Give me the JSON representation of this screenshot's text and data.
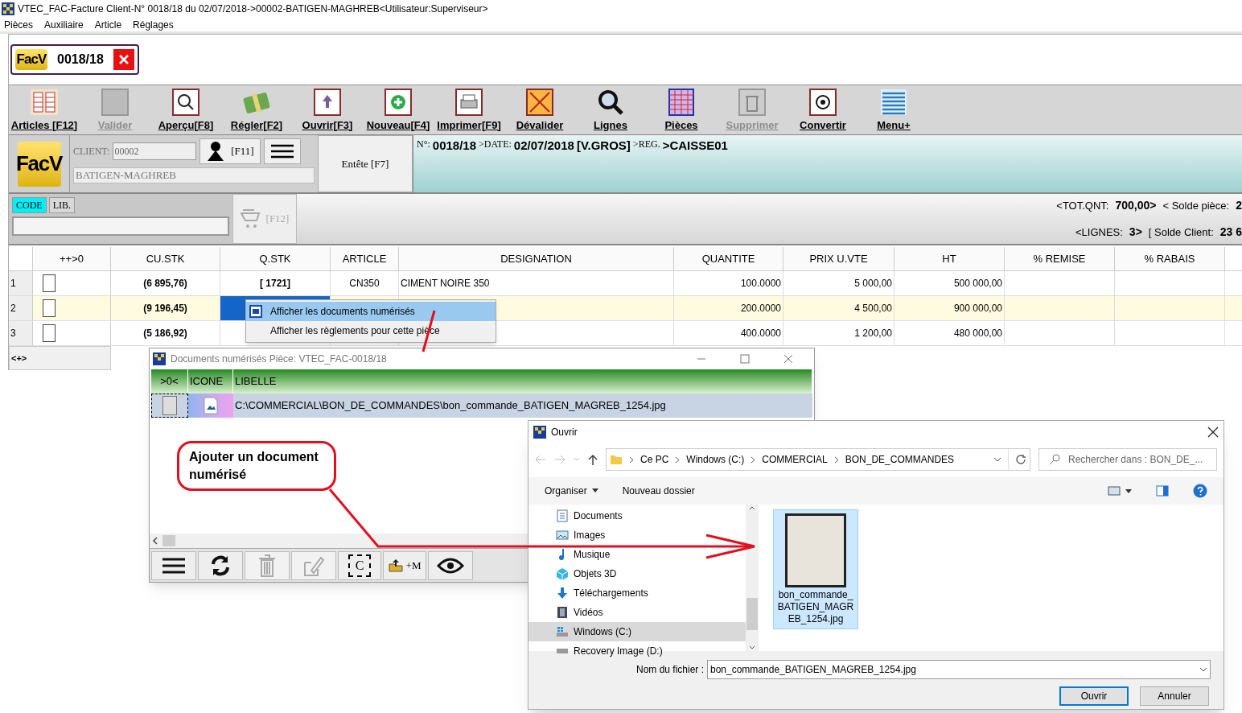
{
  "window": {
    "title": "VTEC_FAC-Facture Client-N° 0018/18 du 02/07/2018->00002-BATIGEN-MAGHREB<Utilisateur:Superviseur>"
  },
  "menu": [
    "Pièces",
    "Auxiliaire",
    "Article",
    "Réglages"
  ],
  "doc_tab": {
    "badge": "FacV",
    "number": "0018/18"
  },
  "toolbar": [
    {
      "label": "Articles [F12]",
      "kind": "grid",
      "disabled": false
    },
    {
      "label": "Valider",
      "kind": "square",
      "disabled": true
    },
    {
      "label": "Aperçu[F8]",
      "kind": "preview",
      "disabled": false
    },
    {
      "label": "Régler[F2]",
      "kind": "money",
      "disabled": false
    },
    {
      "label": "Ouvrir[F3]",
      "kind": "upload",
      "disabled": false
    },
    {
      "label": "Nouveau[F4]",
      "kind": "add",
      "disabled": false
    },
    {
      "label": "Imprimer[F9]",
      "kind": "printer",
      "disabled": false
    },
    {
      "label": "Dévalider",
      "kind": "cross",
      "disabled": false
    },
    {
      "label": "Lignes",
      "kind": "search",
      "disabled": false
    },
    {
      "label": "Pièces",
      "kind": "pieces",
      "disabled": false
    },
    {
      "label": "Supprimer",
      "kind": "trash",
      "disabled": true
    },
    {
      "label": "Convertir",
      "kind": "convert",
      "disabled": false
    },
    {
      "label": "Menu+",
      "kind": "menu",
      "disabled": false
    }
  ],
  "client": {
    "badge": "FacV",
    "label": "CLIENT:",
    "code": "00002",
    "name": "BATIGEN-MAGHREB",
    "lookup_key": "[F11]",
    "header_button": "Entête [F7]"
  },
  "info_strip": [
    {
      "text": "N°:",
      "kind": "label"
    },
    {
      "text": "0018/18",
      "kind": "value"
    },
    {
      "text": ">DATE:",
      "kind": "label"
    },
    {
      "text": "02/07/2018",
      "kind": "value"
    },
    {
      "text": "[V.GROS]",
      "kind": "value"
    },
    {
      "text": ">REG.",
      "kind": "label"
    },
    {
      "text": ">CAISSE01",
      "kind": "value"
    }
  ],
  "search": {
    "modes": [
      {
        "label": "CODE",
        "selected": true
      },
      {
        "label": "LIB.",
        "selected": false
      }
    ],
    "cart_key": "[F12]"
  },
  "totals": [
    [
      {
        "text": "<TOT.QNT:",
        "kind": "label"
      },
      {
        "text": "700,00>",
        "kind": "value"
      },
      {
        "text": "< Solde pièce:",
        "kind": "label"
      },
      {
        "text": "2",
        "kind": "value"
      }
    ],
    [
      {
        "text": "<LIGNES:",
        "kind": "label"
      },
      {
        "text": "3>",
        "kind": "value"
      },
      {
        "text": "[ Solde Client:",
        "kind": "label"
      },
      {
        "text": "23 6",
        "kind": "value"
      }
    ]
  ],
  "table": {
    "columns": [
      "++>0",
      "CU.STK",
      "Q.STK",
      "ARTICLE",
      "DESIGNATION",
      "QUANTITE",
      "PRIX U.VTE",
      "HT",
      "% REMISE",
      "% RABAIS"
    ],
    "rows": [
      {
        "number": "1",
        "checked": false,
        "selected": false,
        "cu_stk": "(6 895,76)",
        "q_stk": "[ 1721]",
        "article": "CN350",
        "designation": "CIMENT NOIRE 350",
        "quantite": "100.0000",
        "prix": "5 000,00",
        "ht": "500 000,00"
      },
      {
        "number": "2",
        "checked": false,
        "selected": true,
        "cu_stk": "(9 196,45)",
        "quantite": "200.0000",
        "prix": "4 500,00",
        "ht": "900 000,00"
      },
      {
        "number": "3",
        "checked": false,
        "selected": false,
        "cu_stk": "(5 186,92)",
        "quantite": "400.0000",
        "prix": "1 200,00",
        "ht": "480 000,00"
      }
    ],
    "footer": "<+>"
  },
  "context_menu": [
    {
      "label": "Afficher les documents numérisés",
      "selected": true
    },
    {
      "label": "Afficher les règlements pour cette pièce",
      "selected": false
    }
  ],
  "docs_dialog": {
    "title": "Documents numérisés Pièce: VTEC_FAC-0018/18",
    "columns": [
      ">0<",
      "ICONE",
      "LIBELLE"
    ],
    "rows": [
      {
        "path": "C:\\COMMERCIAL\\BON_DE_COMMANDES\\bon_commande_BATIGEN_MAGREB_1254.jpg",
        "selected": true
      }
    ],
    "tools": [
      {
        "kind": "menu",
        "disabled": false
      },
      {
        "kind": "refresh",
        "disabled": false
      },
      {
        "kind": "trash",
        "disabled": true
      },
      {
        "kind": "edit",
        "disabled": true
      },
      {
        "kind": "capture",
        "label": "C",
        "disabled": false
      },
      {
        "kind": "upload",
        "label": "+M",
        "disabled": false
      },
      {
        "kind": "eye",
        "disabled": false
      }
    ]
  },
  "annotation": {
    "text": "Ajouter un document numérisé"
  },
  "open_dialog": {
    "title": "Ouvrir",
    "breadcrumb": [
      "Ce PC",
      "Windows (C:)",
      "COMMERCIAL",
      "BON_DE_COMMANDES"
    ],
    "search_placeholder": "Rechercher dans : BON_DE_...",
    "organize": "Organiser",
    "new_folder": "Nouveau dossier",
    "nav": [
      {
        "label": "Documents",
        "kind": "doc",
        "selected": false
      },
      {
        "label": "Images",
        "kind": "image",
        "selected": false
      },
      {
        "label": "Musique",
        "kind": "music",
        "selected": false
      },
      {
        "label": "Objets 3D",
        "kind": "cube",
        "selected": false
      },
      {
        "label": "Téléchargements",
        "kind": "download",
        "selected": false
      },
      {
        "label": "Vidéos",
        "kind": "video",
        "selected": false
      },
      {
        "label": "Windows (C:)",
        "kind": "drive",
        "selected": true
      },
      {
        "label": "Recovery Image (D:)",
        "kind": "disk",
        "selected": false
      }
    ],
    "files": [
      {
        "name": "bon_commande_BATIGEN_MAGREB_1254.jpg",
        "selected": true
      }
    ],
    "filename_label": "Nom du fichier :",
    "filename": "bon_commande_BATIGEN_MAGREB_1254.jpg",
    "buttons": [
      {
        "label": "Ouvrir",
        "kind": "primary"
      },
      {
        "label": "Annuler",
        "kind": "secondary"
      }
    ]
  }
}
